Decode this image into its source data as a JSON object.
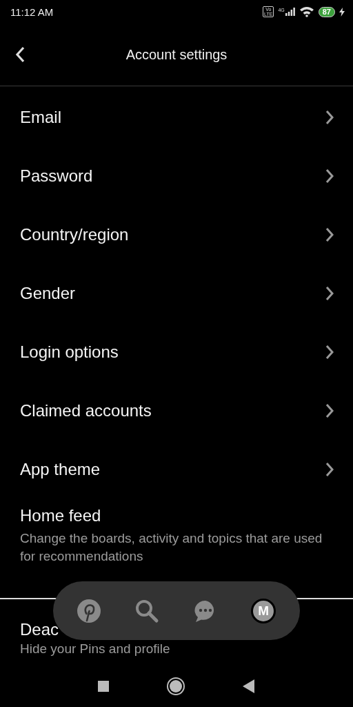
{
  "status_bar": {
    "time": "11:12 AM",
    "volte": [
      "Vo",
      "LTE"
    ],
    "network_type": "4G",
    "battery": "87",
    "charging": true
  },
  "header": {
    "title": "Account settings"
  },
  "items": [
    {
      "label": "Email",
      "kind": "link"
    },
    {
      "label": "Password",
      "kind": "link"
    },
    {
      "label": "Country/region",
      "kind": "link"
    },
    {
      "label": "Gender",
      "kind": "link"
    },
    {
      "label": "Login options",
      "kind": "link"
    },
    {
      "label": "Claimed accounts",
      "kind": "link"
    },
    {
      "label": "App theme",
      "kind": "link"
    },
    {
      "label": "Home feed",
      "kind": "described",
      "description": "Change the boards, activity and topics that are used for recommendations"
    }
  ],
  "lower_items": [
    {
      "label": "Deac",
      "description": "Hide your Pins and profile"
    }
  ],
  "bottom_nav": {
    "items": [
      {
        "kind": "home"
      },
      {
        "kind": "search"
      },
      {
        "kind": "messages"
      },
      {
        "kind": "profile",
        "initial": "M"
      }
    ]
  }
}
